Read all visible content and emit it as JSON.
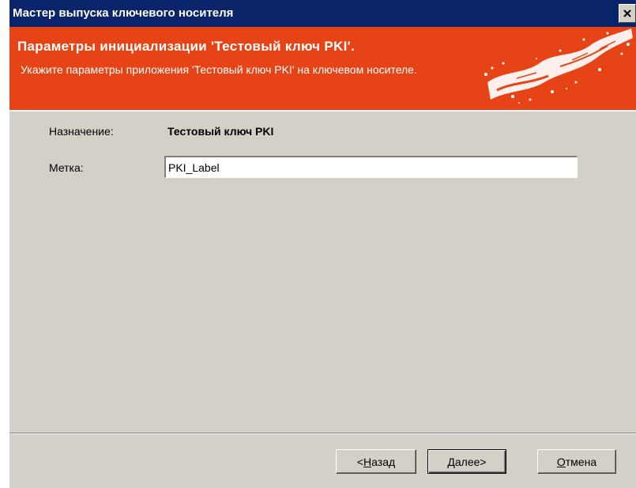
{
  "window": {
    "title": "Мастер выпуска ключевого носителя",
    "close_glyph": "✕"
  },
  "header": {
    "title": "Параметры инициализации 'Тестовый ключ PKI'.",
    "subtitle": "Укажите параметры приложения 'Тестовый ключ PKI' на ключевом носителе.",
    "background": "#e64416",
    "art_icon": "splash-banner-art"
  },
  "form": {
    "purpose_label": "Назначение:",
    "purpose_value": "Тестовый ключ PKI",
    "tag_label": "Метка:",
    "tag_value": "PKI_Label"
  },
  "buttons": {
    "back": {
      "prefix": "< ",
      "mnemonic": "Н",
      "rest": "азад"
    },
    "next": {
      "mnemonic": "Д",
      "rest": "алее",
      "suffix": " >"
    },
    "cancel": {
      "mnemonic": "О",
      "rest": "тмена"
    }
  },
  "colors": {
    "titlebar": "#0a246a",
    "face": "#d4d0c8"
  }
}
